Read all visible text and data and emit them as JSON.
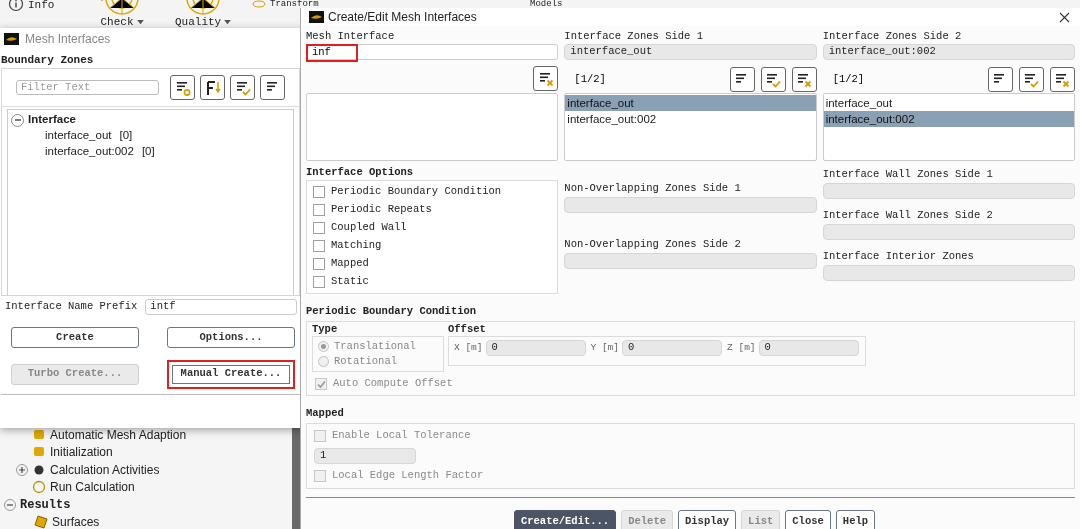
{
  "ribbon": [
    {
      "label": "Info"
    },
    {
      "label": "Check"
    },
    {
      "label": "Quality"
    },
    {
      "label": "Transform"
    },
    {
      "label": "Models"
    }
  ],
  "outline_tree": [
    {
      "label": "Automatic Mesh Adaption"
    },
    {
      "label": "Initialization"
    },
    {
      "label": "Calculation Activities",
      "expanded": false
    },
    {
      "label": "Run Calculation"
    },
    {
      "label": "Results",
      "expanded": true,
      "children": [
        {
          "label": "Surfaces"
        }
      ]
    }
  ],
  "mesh_interfaces": {
    "title": "Mesh Interfaces",
    "boundary_zones": {
      "label": "Boundary Zones",
      "filter": {
        "placeholder": "Filter Text"
      },
      "tree": [
        {
          "label": "Interface",
          "expanded": true,
          "children": [
            {
              "label": "interface_out",
              "count": "[0]"
            },
            {
              "label": "interface_out:002",
              "count": "[0]"
            }
          ]
        }
      ]
    },
    "prefix": {
      "label": "Interface Name Prefix",
      "value": "intf"
    },
    "buttons": [
      {
        "label": "Create",
        "disabled": false,
        "highlighted": false
      },
      {
        "label": "Options...",
        "disabled": false,
        "highlighted": false
      },
      {
        "label": "Turbo Create...",
        "disabled": true,
        "highlighted": false
      },
      {
        "label": "Manual Create...",
        "disabled": false,
        "highlighted": true
      }
    ]
  },
  "create_edit": {
    "title": "Create/Edit Mesh Interfaces",
    "mesh_interface": {
      "label": "Mesh Interface",
      "value": "inf",
      "highlighted": true
    },
    "zone_sides": [
      {
        "label": "Interface Zones Side 1",
        "value": "interface_out",
        "count": "[1/2]",
        "items": [
          {
            "label": "interface_out",
            "selected": true
          },
          {
            "label": "interface_out:002",
            "selected": false
          }
        ]
      },
      {
        "label": "Interface Zones Side 2",
        "value": "interface_out:002",
        "count": "[1/2]",
        "items": [
          {
            "label": "interface_out",
            "selected": false
          },
          {
            "label": "interface_out:002",
            "selected": true
          }
        ]
      }
    ],
    "interface_options": {
      "label": "Interface Options",
      "options": [
        {
          "label": "Periodic Boundary Condition",
          "checked": false
        },
        {
          "label": "Periodic Repeats",
          "checked": false
        },
        {
          "label": "Coupled Wall",
          "checked": false
        },
        {
          "label": "Matching",
          "checked": false
        },
        {
          "label": "Mapped",
          "checked": false
        },
        {
          "label": "Static",
          "checked": false
        }
      ]
    },
    "non_overlapping": [
      {
        "label": "Non-Overlapping Zones Side 1"
      },
      {
        "label": "Non-Overlapping Zones Side 2"
      }
    ],
    "wall_zones": [
      {
        "label": "Interface Wall Zones Side 1"
      },
      {
        "label": "Interface Wall Zones Side 2"
      },
      {
        "label": "Interface Interior Zones"
      }
    ],
    "periodic": {
      "label": "Periodic Boundary Condition",
      "type": {
        "label": "Type",
        "disabled": true,
        "options": [
          {
            "label": "Translational",
            "selected": true
          },
          {
            "label": "Rotational",
            "selected": false
          }
        ]
      },
      "offset": {
        "label": "Offset",
        "fields": [
          {
            "label": "X [m]",
            "value": "0"
          },
          {
            "label": "Y [m]",
            "value": "0"
          },
          {
            "label": "Z [m]",
            "value": "0"
          }
        ]
      },
      "auto_compute": {
        "label": "Auto Compute Offset",
        "checked": true,
        "disabled": true
      }
    },
    "mapped": {
      "label": "Mapped",
      "tolerance": {
        "label": "Enable Local Tolerance",
        "checked": false,
        "disabled": true
      },
      "value": "1",
      "edge_factor": {
        "label": "Local Edge Length Factor",
        "checked": false,
        "disabled": true
      }
    },
    "buttons": [
      {
        "label": "Create/Edit...",
        "kind": "primary",
        "disabled": false
      },
      {
        "label": "Delete",
        "kind": "normal",
        "disabled": true
      },
      {
        "label": "Display",
        "kind": "normal",
        "disabled": false
      },
      {
        "label": "List",
        "kind": "normal",
        "disabled": true
      },
      {
        "label": "Close",
        "kind": "normal",
        "disabled": false
      },
      {
        "label": "Help",
        "kind": "normal",
        "disabled": false
      }
    ]
  }
}
